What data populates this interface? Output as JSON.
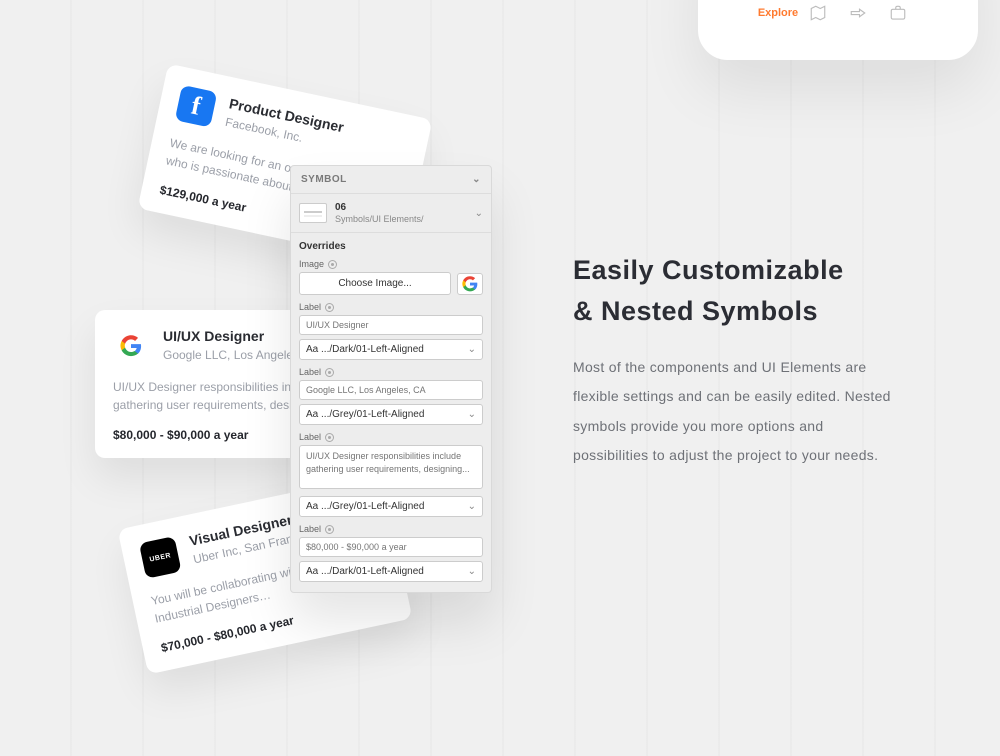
{
  "phone_nav": {
    "active_label": "Explore"
  },
  "cards": {
    "facebook": {
      "title": "Product Designer",
      "company": "Facebook, Inc.",
      "desc": "We are looking for an outstanding Designer who is passionate about…",
      "salary": "$129,000 a year"
    },
    "google": {
      "title": "UI/UX Designer",
      "company": "Google LLC, Los Angeles",
      "desc": "UI/UX Designer responsibilities include gathering user requirements, designing…",
      "salary": "$80,000 - $90,000 a year"
    },
    "uber": {
      "title": "Visual Designer",
      "company": "Uber Inc, San Francisco",
      "desc": "You will be collaborating with Directors, Industrial Designers…",
      "salary": "$70,000 - $80,000 a year"
    }
  },
  "panel": {
    "header": "SYMBOL",
    "symbol_num": "06",
    "symbol_path": "Symbols/UI Elements/",
    "section_title": "Overrides",
    "image_label": "Image",
    "choose_image": "Choose Image...",
    "label": "Label",
    "field1_placeholder": "UI/UX Designer",
    "select_dark": "Aa .../Dark/01-Left-Aligned",
    "field2_placeholder": "Google LLC, Los Angeles, CA",
    "select_grey": "Aa .../Grey/01-Left-Aligned",
    "field3_placeholder": "UI/UX Designer responsibilities include gathering user requirements, designing...",
    "field4_placeholder": "$80,000 - $90,000 a year"
  },
  "copy": {
    "heading_line1": "Easily Customizable",
    "heading_line2": "& Nested Symbols",
    "body": "Most of the components and UI Elements are flexible settings and can be easily edited. Nested symbols provide you more options and possibilities to adjust the project to your needs."
  }
}
